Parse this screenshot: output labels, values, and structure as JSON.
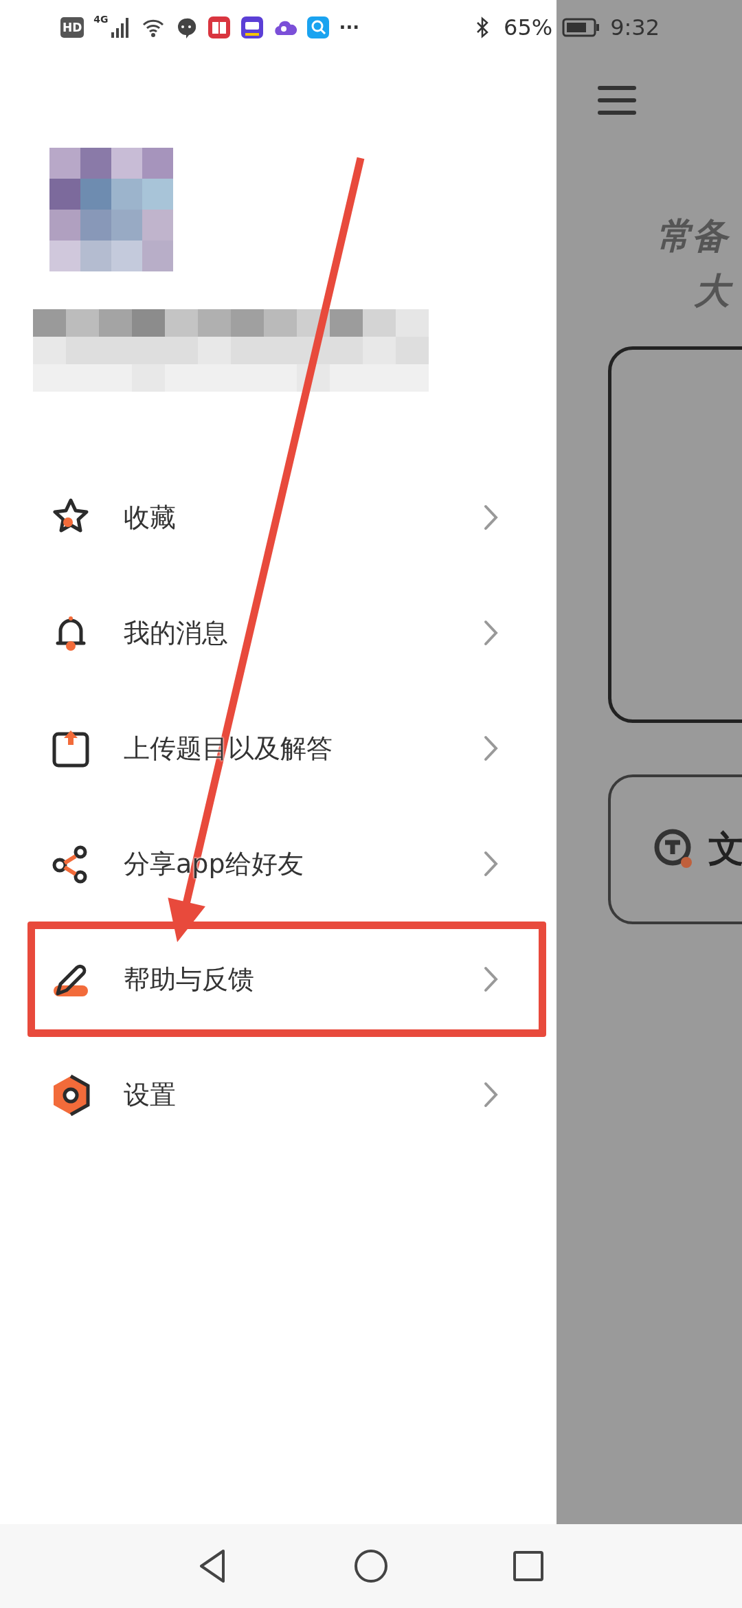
{
  "status_bar": {
    "hd": "HD",
    "network": "4G",
    "more": "···",
    "battery": "65%",
    "time": "9:32"
  },
  "profile": {
    "name_blurred": true
  },
  "drawer": {
    "items": [
      {
        "label": "收藏",
        "highlighted": false
      },
      {
        "label": "我的消息",
        "highlighted": false
      },
      {
        "label": "上传题目以及解答",
        "highlighted": false
      },
      {
        "label": "分享app给好友",
        "highlighted": false
      },
      {
        "label": "帮助与反馈",
        "highlighted": true
      },
      {
        "label": "设置",
        "highlighted": false
      }
    ]
  },
  "main": {
    "title_lines": [
      "常备",
      "大"
    ],
    "button_label": "文"
  },
  "annotation": {
    "arrow": true
  }
}
